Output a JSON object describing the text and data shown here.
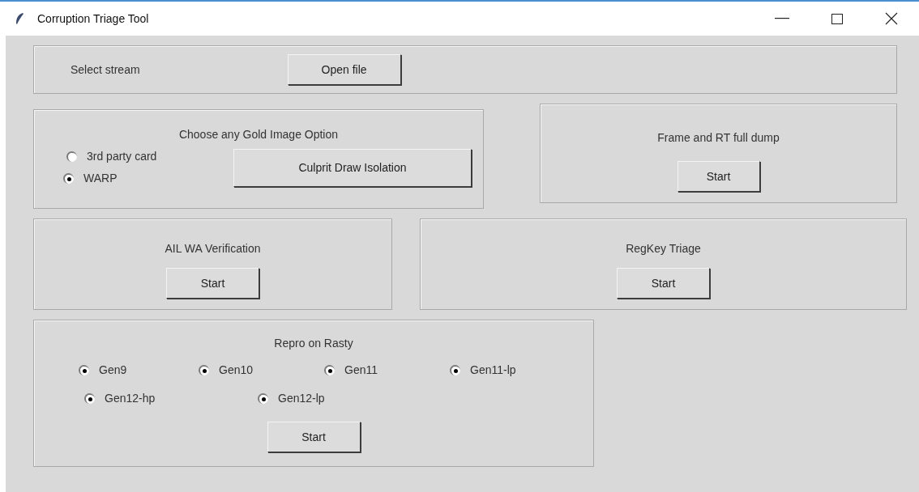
{
  "window": {
    "title": "Corruption Triage Tool"
  },
  "stream": {
    "label": "Select stream",
    "button": "Open file"
  },
  "gold_image": {
    "title": "Choose any Gold Image Option",
    "options": [
      {
        "label": "3rd party card",
        "selected": false
      },
      {
        "label": "WARP",
        "selected": true
      }
    ],
    "button": "Culprit Draw Isolation"
  },
  "frame_dump": {
    "title": "Frame and RT full dump",
    "button": "Start"
  },
  "ail": {
    "title": "AIL WA Verification",
    "button": "Start"
  },
  "regkey": {
    "title": "RegKey Triage",
    "button": "Start"
  },
  "repro": {
    "title": "Repro on Rasty",
    "options_row_1": [
      {
        "label": "Gen9",
        "selected": true
      },
      {
        "label": "Gen10",
        "selected": true
      },
      {
        "label": "Gen11",
        "selected": true
      },
      {
        "label": "Gen11-lp",
        "selected": true
      }
    ],
    "options_row_2": [
      {
        "label": "Gen12-hp",
        "selected": true
      },
      {
        "label": "Gen12-lp",
        "selected": true
      }
    ],
    "button": "Start"
  }
}
